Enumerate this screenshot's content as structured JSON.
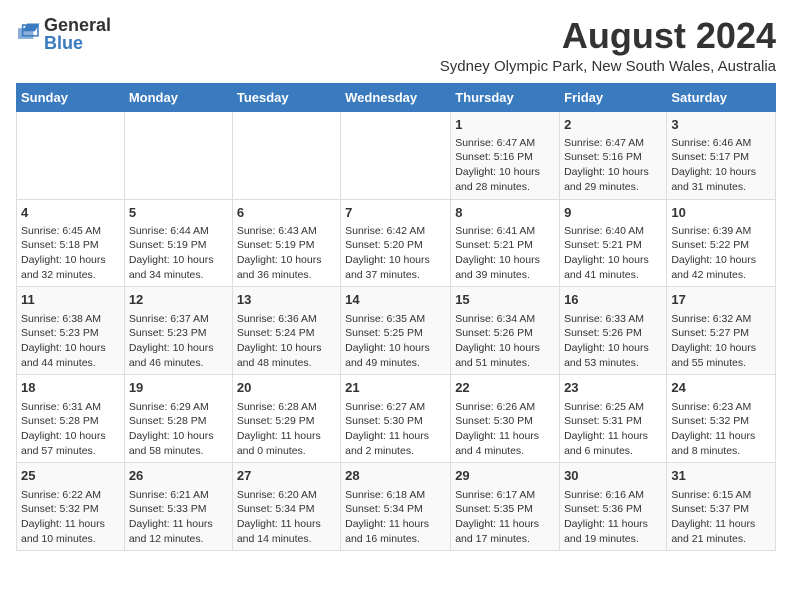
{
  "logo": {
    "general": "General",
    "blue": "Blue"
  },
  "title": "August 2024",
  "subtitle": "Sydney Olympic Park, New South Wales, Australia",
  "weekdays": [
    "Sunday",
    "Monday",
    "Tuesday",
    "Wednesday",
    "Thursday",
    "Friday",
    "Saturday"
  ],
  "weeks": [
    [
      {
        "day": "",
        "content": ""
      },
      {
        "day": "",
        "content": ""
      },
      {
        "day": "",
        "content": ""
      },
      {
        "day": "",
        "content": ""
      },
      {
        "day": "1",
        "content": "Sunrise: 6:47 AM\nSunset: 5:16 PM\nDaylight: 10 hours\nand 28 minutes."
      },
      {
        "day": "2",
        "content": "Sunrise: 6:47 AM\nSunset: 5:16 PM\nDaylight: 10 hours\nand 29 minutes."
      },
      {
        "day": "3",
        "content": "Sunrise: 6:46 AM\nSunset: 5:17 PM\nDaylight: 10 hours\nand 31 minutes."
      }
    ],
    [
      {
        "day": "4",
        "content": "Sunrise: 6:45 AM\nSunset: 5:18 PM\nDaylight: 10 hours\nand 32 minutes."
      },
      {
        "day": "5",
        "content": "Sunrise: 6:44 AM\nSunset: 5:19 PM\nDaylight: 10 hours\nand 34 minutes."
      },
      {
        "day": "6",
        "content": "Sunrise: 6:43 AM\nSunset: 5:19 PM\nDaylight: 10 hours\nand 36 minutes."
      },
      {
        "day": "7",
        "content": "Sunrise: 6:42 AM\nSunset: 5:20 PM\nDaylight: 10 hours\nand 37 minutes."
      },
      {
        "day": "8",
        "content": "Sunrise: 6:41 AM\nSunset: 5:21 PM\nDaylight: 10 hours\nand 39 minutes."
      },
      {
        "day": "9",
        "content": "Sunrise: 6:40 AM\nSunset: 5:21 PM\nDaylight: 10 hours\nand 41 minutes."
      },
      {
        "day": "10",
        "content": "Sunrise: 6:39 AM\nSunset: 5:22 PM\nDaylight: 10 hours\nand 42 minutes."
      }
    ],
    [
      {
        "day": "11",
        "content": "Sunrise: 6:38 AM\nSunset: 5:23 PM\nDaylight: 10 hours\nand 44 minutes."
      },
      {
        "day": "12",
        "content": "Sunrise: 6:37 AM\nSunset: 5:23 PM\nDaylight: 10 hours\nand 46 minutes."
      },
      {
        "day": "13",
        "content": "Sunrise: 6:36 AM\nSunset: 5:24 PM\nDaylight: 10 hours\nand 48 minutes."
      },
      {
        "day": "14",
        "content": "Sunrise: 6:35 AM\nSunset: 5:25 PM\nDaylight: 10 hours\nand 49 minutes."
      },
      {
        "day": "15",
        "content": "Sunrise: 6:34 AM\nSunset: 5:26 PM\nDaylight: 10 hours\nand 51 minutes."
      },
      {
        "day": "16",
        "content": "Sunrise: 6:33 AM\nSunset: 5:26 PM\nDaylight: 10 hours\nand 53 minutes."
      },
      {
        "day": "17",
        "content": "Sunrise: 6:32 AM\nSunset: 5:27 PM\nDaylight: 10 hours\nand 55 minutes."
      }
    ],
    [
      {
        "day": "18",
        "content": "Sunrise: 6:31 AM\nSunset: 5:28 PM\nDaylight: 10 hours\nand 57 minutes."
      },
      {
        "day": "19",
        "content": "Sunrise: 6:29 AM\nSunset: 5:28 PM\nDaylight: 10 hours\nand 58 minutes."
      },
      {
        "day": "20",
        "content": "Sunrise: 6:28 AM\nSunset: 5:29 PM\nDaylight: 11 hours\nand 0 minutes."
      },
      {
        "day": "21",
        "content": "Sunrise: 6:27 AM\nSunset: 5:30 PM\nDaylight: 11 hours\nand 2 minutes."
      },
      {
        "day": "22",
        "content": "Sunrise: 6:26 AM\nSunset: 5:30 PM\nDaylight: 11 hours\nand 4 minutes."
      },
      {
        "day": "23",
        "content": "Sunrise: 6:25 AM\nSunset: 5:31 PM\nDaylight: 11 hours\nand 6 minutes."
      },
      {
        "day": "24",
        "content": "Sunrise: 6:23 AM\nSunset: 5:32 PM\nDaylight: 11 hours\nand 8 minutes."
      }
    ],
    [
      {
        "day": "25",
        "content": "Sunrise: 6:22 AM\nSunset: 5:32 PM\nDaylight: 11 hours\nand 10 minutes."
      },
      {
        "day": "26",
        "content": "Sunrise: 6:21 AM\nSunset: 5:33 PM\nDaylight: 11 hours\nand 12 minutes."
      },
      {
        "day": "27",
        "content": "Sunrise: 6:20 AM\nSunset: 5:34 PM\nDaylight: 11 hours\nand 14 minutes."
      },
      {
        "day": "28",
        "content": "Sunrise: 6:18 AM\nSunset: 5:34 PM\nDaylight: 11 hours\nand 16 minutes."
      },
      {
        "day": "29",
        "content": "Sunrise: 6:17 AM\nSunset: 5:35 PM\nDaylight: 11 hours\nand 17 minutes."
      },
      {
        "day": "30",
        "content": "Sunrise: 6:16 AM\nSunset: 5:36 PM\nDaylight: 11 hours\nand 19 minutes."
      },
      {
        "day": "31",
        "content": "Sunrise: 6:15 AM\nSunset: 5:37 PM\nDaylight: 11 hours\nand 21 minutes."
      }
    ]
  ]
}
